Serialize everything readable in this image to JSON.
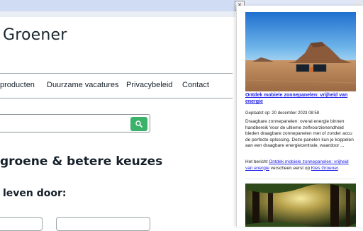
{
  "site": {
    "brand": "Groener",
    "nav": [
      "producten",
      "Duurzame vacatures",
      "Privacybeleid",
      "Contact"
    ],
    "heading": "groene & betere keuzes",
    "subheading": "leven door:"
  },
  "popup": {
    "article": {
      "title": "Ontdek mobiele zonnepanelen: vrijheid van energie",
      "meta": "Geplaatst op: 20 december 2023 08:58",
      "description": "Draagbare zonnepanelen: overal energie binnen handbereik Voor de ultieme zelfvoorzienendheid bieden draagbare zonnepanelen met of zonder accu de perfecte oplossing. Deze panelen kun je koppelen aan een draagbare energiecentrale, waardoor ...",
      "source_prefix": "Het bericht ",
      "source_link": "Ontdek mobiele zonnepanelen: vrijheid van energie",
      "source_mid": " verscheen eerst op ",
      "source_site": "Kies Groener",
      "source_suffix": "."
    }
  },
  "colors": {
    "link": "#1a1ae6",
    "search_button": "#3bb26a",
    "chrome_bar": "#dfe7f7"
  },
  "icons": {
    "search": "magnifier-icon",
    "close": "close-icon"
  }
}
